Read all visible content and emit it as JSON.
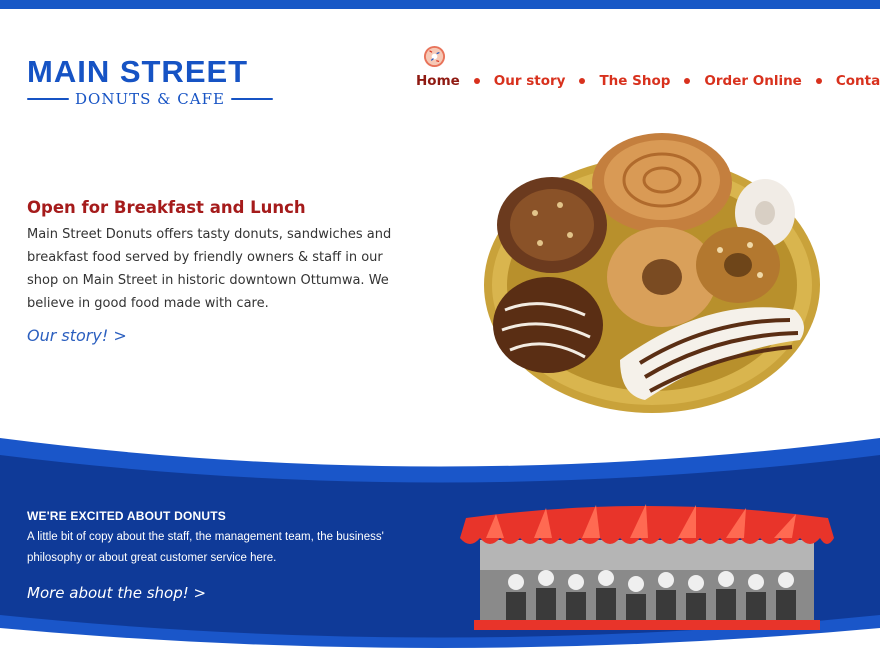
{
  "brand": {
    "name": "MAIN STREET",
    "tagline": "DONUTS & CAFE"
  },
  "nav": {
    "items": [
      {
        "label": "Home",
        "active": true
      },
      {
        "label": "Our story",
        "active": false
      },
      {
        "label": "The Shop",
        "active": false
      },
      {
        "label": "Order Online",
        "active": false
      },
      {
        "label": "Contact",
        "active": false
      }
    ]
  },
  "hero": {
    "heading": "Open for Breakfast and Lunch",
    "text": "Main Street Donuts offers tasty donuts, sandwiches and breakfast food served by friendly owners & staff in our shop on Main Street in historic downtown Ottumwa. We believe in good food made with care.",
    "link": "Our story! >"
  },
  "about": {
    "title": "WE'RE EXCITED ABOUT DONUTS",
    "text": "A little bit of copy about the staff, the management team, the business' philosophy or about great customer service here.",
    "link": "More about the shop! >"
  },
  "icons": {
    "nav_icon": "donut-icon",
    "hero_image": "donut-tray-photo",
    "shop_image": "shop-awning-staff-photo"
  },
  "colors": {
    "brand_blue": "#1653c4",
    "nav_red": "#d8311d",
    "heading_red": "#a51b1b",
    "band_blue": "#0f3fa0",
    "awning_red": "#e8342a"
  }
}
